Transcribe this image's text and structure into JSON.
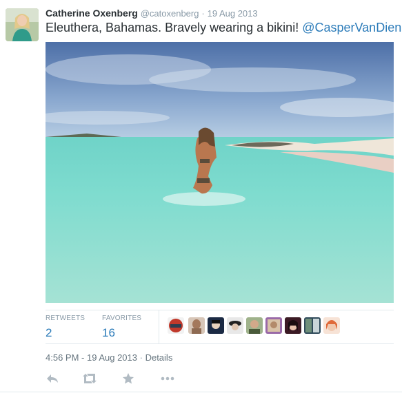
{
  "tweet": {
    "fullname": "Catherine Oxenberg",
    "screenname": "@catoxenberg",
    "separator": "·",
    "date": "19 Aug 2013",
    "text": "Eleuthera, Bahamas. Bravely wearing a bikini! ",
    "mention": "@CasperVanDien"
  },
  "stats": {
    "retweets_label": "RETWEETS",
    "retweets_count": "2",
    "favorites_label": "FAVORITES",
    "favorites_count": "16"
  },
  "meta": {
    "time": "4:56 PM - 19 Aug 2013",
    "separator": "·",
    "details_label": "Details"
  },
  "actions": [
    "reply-icon",
    "retweet-icon",
    "favorite-icon",
    "more-icon"
  ],
  "colors": {
    "link": "#2b7bb9",
    "muted": "#8899a6",
    "action_icon": "#b1bbc3"
  }
}
